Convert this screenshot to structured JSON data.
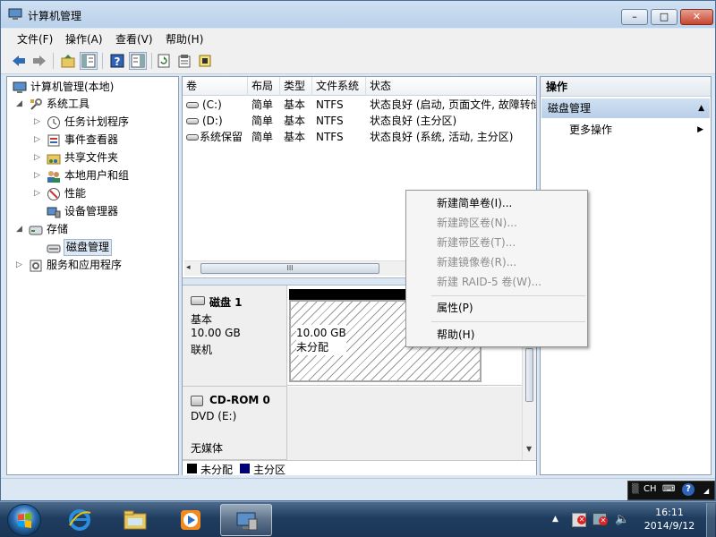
{
  "window": {
    "title": "计算机管理"
  },
  "menu": [
    "文件(F)",
    "操作(A)",
    "查看(V)",
    "帮助(H)"
  ],
  "toolbar_icons": [
    "back-arrow-icon",
    "forward-arrow-icon",
    "up-folder-icon",
    "show-hide-tree-icon",
    "help-icon",
    "show-action-pane-icon",
    "refresh-icon",
    "properties-icon",
    "export-icon"
  ],
  "tree": {
    "root": "计算机管理(本地)",
    "items": [
      {
        "label": "系统工具",
        "icon": "tools-icon"
      },
      {
        "label": "任务计划程序",
        "icon": "clock-icon"
      },
      {
        "label": "事件查看器",
        "icon": "event-viewer-icon"
      },
      {
        "label": "共享文件夹",
        "icon": "shared-folder-icon"
      },
      {
        "label": "本地用户和组",
        "icon": "users-icon"
      },
      {
        "label": "性能",
        "icon": "performance-icon"
      },
      {
        "label": "设备管理器",
        "icon": "device-manager-icon"
      },
      {
        "label": "存储",
        "icon": "storage-icon"
      },
      {
        "label": "磁盘管理",
        "icon": "disk-management-icon"
      },
      {
        "label": "服务和应用程序",
        "icon": "services-icon"
      }
    ]
  },
  "volumes": {
    "headers": [
      "卷",
      "布局",
      "类型",
      "文件系统",
      "状态"
    ],
    "rows": [
      [
        "(C:)",
        "简单",
        "基本",
        "NTFS",
        "状态良好 (启动, 页面文件, 故障转储"
      ],
      [
        "(D:)",
        "简单",
        "基本",
        "NTFS",
        "状态良好 (主分区)"
      ],
      [
        "系统保留",
        "简单",
        "基本",
        "NTFS",
        "状态良好 (系统, 活动, 主分区)"
      ]
    ],
    "scroll_label": "III"
  },
  "disk1": {
    "name": "磁盘 1",
    "type": "基本",
    "size": "10.00 GB",
    "status": "联机",
    "partition_size": "10.00 GB",
    "partition_status": "未分配"
  },
  "cdrom": {
    "name": "CD-ROM 0",
    "drive": "DVD (E:)",
    "status": "无媒体"
  },
  "legend": [
    {
      "label": "未分配",
      "color": "#000000"
    },
    {
      "label": "主分区",
      "color": "#00007a"
    }
  ],
  "actions": {
    "header": "操作",
    "section": "磁盘管理",
    "more": "更多操作"
  },
  "context_menu": {
    "items": [
      {
        "label": "新建简单卷(I)...",
        "enabled": true
      },
      {
        "label": "新建跨区卷(N)...",
        "enabled": false
      },
      {
        "label": "新建带区卷(T)...",
        "enabled": false
      },
      {
        "label": "新建镜像卷(R)...",
        "enabled": false
      },
      {
        "label": "新建 RAID-5 卷(W)...",
        "enabled": false
      },
      {
        "label": "属性(P)",
        "enabled": true
      },
      {
        "label": "帮助(H)",
        "enabled": true
      }
    ]
  },
  "langbar": {
    "lang": "CH"
  },
  "clock": {
    "time": "16:11",
    "date": "2014/9/12"
  }
}
